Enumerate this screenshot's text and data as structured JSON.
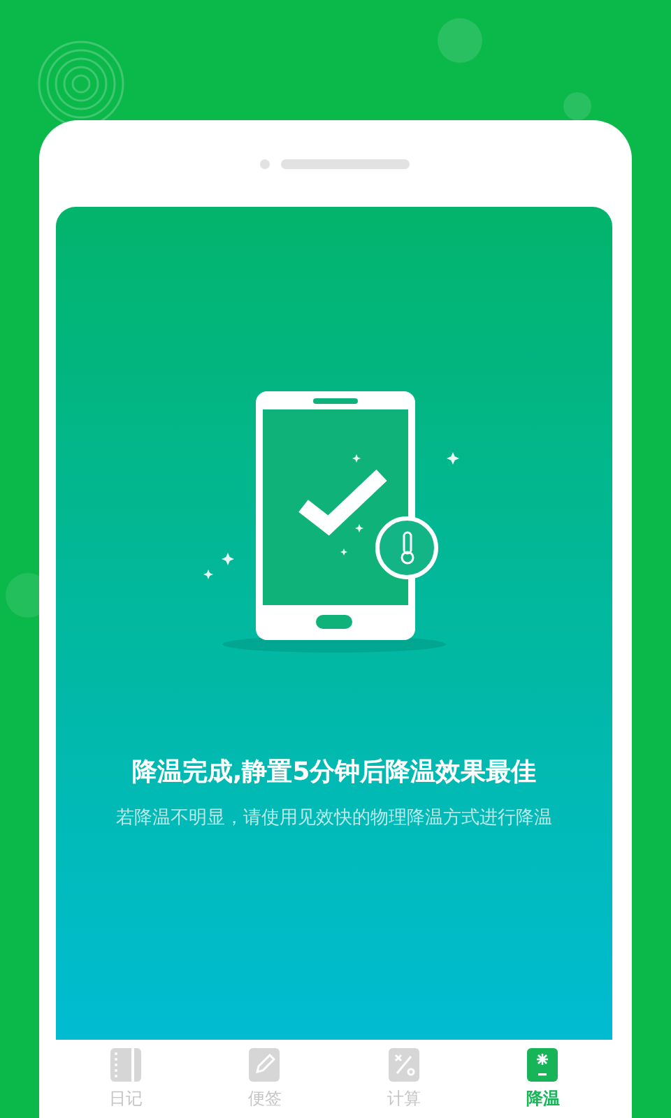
{
  "result": {
    "title": "降温完成,静置5分钟后降温效果最佳",
    "subtitle": "若降温不明显，请使用见效快的物理降温方式进行降温"
  },
  "nav_tabs": [
    {
      "label": "日记",
      "selected": false
    },
    {
      "label": "便签",
      "selected": false
    },
    {
      "label": "计算",
      "selected": false
    },
    {
      "label": "降温",
      "selected": true
    }
  ]
}
